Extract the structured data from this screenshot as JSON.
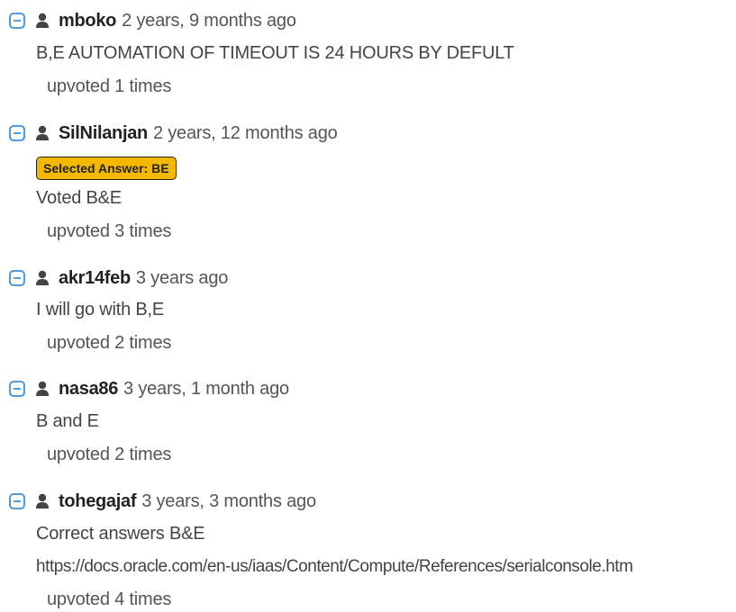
{
  "comments": [
    {
      "username": "mboko",
      "date": "2 years, 9 months ago",
      "lines": [
        "B,E AUTOMATION OF TIMEOUT IS 24 HOURS BY DEFULT"
      ],
      "votes": "upvoted 1 times"
    },
    {
      "username": "SilNilanjan",
      "date": "2 years, 12 months ago",
      "badge": "Selected Answer: BE",
      "lines": [
        "Voted B&E"
      ],
      "votes": "upvoted 3 times"
    },
    {
      "username": "akr14feb",
      "date": "3 years ago",
      "lines": [
        "I will go with B,E"
      ],
      "votes": "upvoted 2 times"
    },
    {
      "username": "nasa86",
      "date": "3 years, 1 month ago",
      "lines": [
        "B and E"
      ],
      "votes": "upvoted 2 times"
    },
    {
      "username": "tohegajaf",
      "date": "3 years, 3 months ago",
      "lines": [
        "Correct answers B&E",
        "https://docs.oracle.com/en-us/iaas/Content/Compute/References/serialconsole.htm"
      ],
      "votes": "upvoted 4 times"
    }
  ],
  "icons": {
    "toggle": "collapse-minus-icon",
    "user": "user-icon"
  },
  "colors": {
    "toggle_blue": "#3a8fd6",
    "badge_yellow": "#f5b800"
  }
}
